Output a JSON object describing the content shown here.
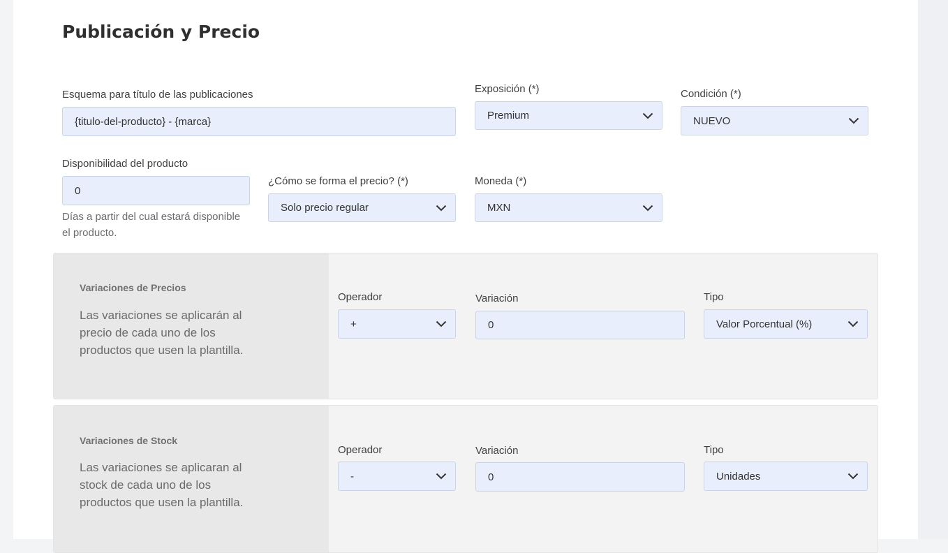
{
  "section": {
    "title": "Publicación y Precio"
  },
  "fields": {
    "title_scheme": {
      "label": "Esquema para título de las publicaciones",
      "value": "{titulo-del-producto} - {marca}"
    },
    "exposure": {
      "label": "Exposición (*)",
      "value": "Premium"
    },
    "condition": {
      "label": "Condición (*)",
      "value": "NUEVO"
    },
    "availability": {
      "label": "Disponibilidad del producto",
      "value": "0",
      "help_line1": "Días a partir del cual estará disponible",
      "help_line2": "el producto."
    },
    "price_formation": {
      "label": "¿Cómo se forma el precio? (*)",
      "value": "Solo precio regular"
    },
    "currency": {
      "label": "Moneda (*)",
      "value": "MXN"
    }
  },
  "price_variations": {
    "title": "Variaciones de Precios",
    "desc_line1": "Las variaciones se aplicarán al",
    "desc_line2": "precio de cada uno de los",
    "desc_line3": "productos que usen la plantilla.",
    "operator_label": "Operador",
    "operator_value": "+",
    "variation_label": "Variación",
    "variation_value": "0",
    "type_label": "Tipo",
    "type_value": "Valor Porcentual (%)"
  },
  "stock_variations": {
    "title": "Variaciones de Stock",
    "desc_line1": "Las variaciones se aplicaran al",
    "desc_line2": "stock de cada uno de los",
    "desc_line3": "productos que usen la plantilla.",
    "operator_label": "Operador",
    "operator_value": "-",
    "variation_label": "Variación",
    "variation_value": "0",
    "type_label": "Tipo",
    "type_value": "Unidades"
  },
  "icons": {
    "select_arrow": "chevron-down-icon"
  },
  "colors": {
    "field_bg": "#e8eefb",
    "panel_bg": "#f3f3f3",
    "panel_side_bg": "#e8e8e8"
  }
}
